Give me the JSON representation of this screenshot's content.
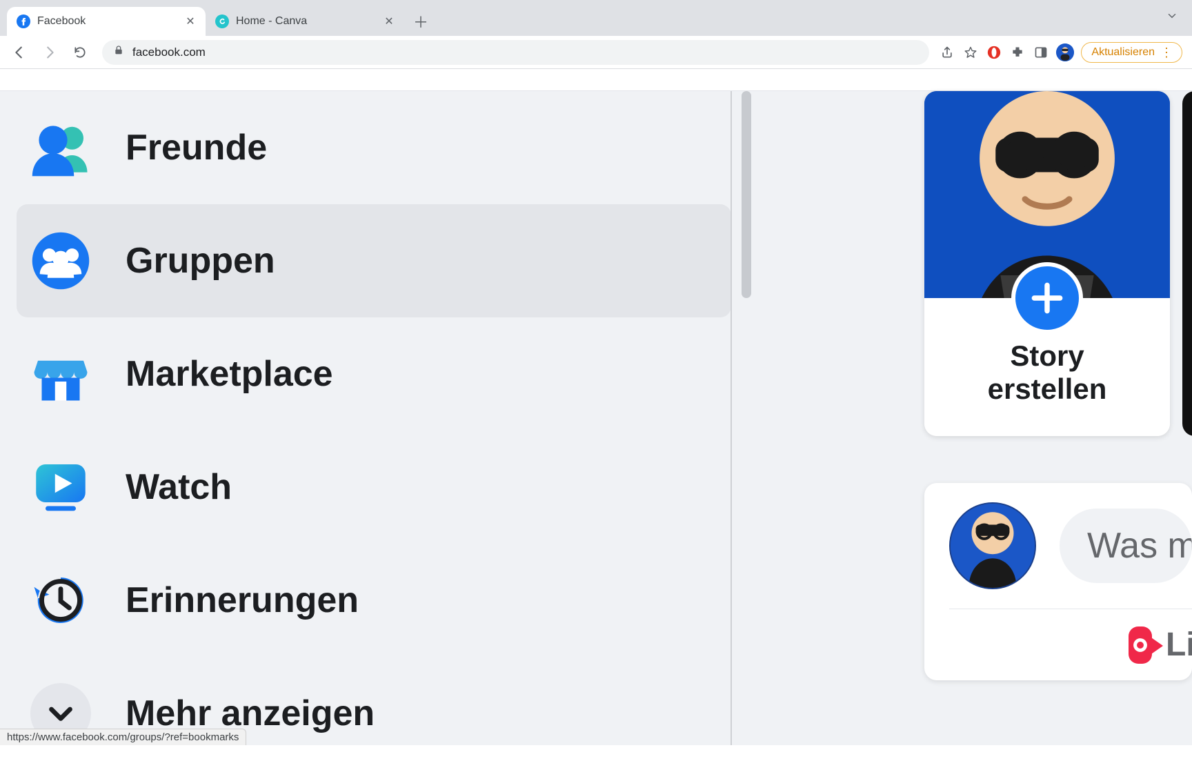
{
  "browser": {
    "tabs": [
      {
        "title": "Facebook",
        "favicon": "fb"
      },
      {
        "title": "Home - Canva",
        "favicon": "canva"
      }
    ],
    "url": "facebook.com",
    "update_label": "Aktualisieren",
    "extension_icons": [
      "opera-red",
      "puzzle",
      "panel"
    ],
    "status_url": "https://www.facebook.com/groups/?ref=bookmarks"
  },
  "sidebar": {
    "items": [
      {
        "id": "friends",
        "label": "Freunde",
        "icon": "friends-icon"
      },
      {
        "id": "groups",
        "label": "Gruppen",
        "icon": "groups-icon",
        "hover": true
      },
      {
        "id": "marketplace",
        "label": "Marketplace",
        "icon": "marketplace-icon"
      },
      {
        "id": "watch",
        "label": "Watch",
        "icon": "watch-icon"
      },
      {
        "id": "memories",
        "label": "Erinnerungen",
        "icon": "memories-icon"
      }
    ],
    "more_label": "Mehr anzeigen"
  },
  "story": {
    "create_label": "Story\nerstellen"
  },
  "composer": {
    "placeholder": "Was m",
    "live_label": "Live-V"
  },
  "colors": {
    "fb_blue": "#1877f2",
    "bg": "#f0f2f5",
    "text": "#1c1e21",
    "muted": "#65676b",
    "red": "#f02849"
  }
}
